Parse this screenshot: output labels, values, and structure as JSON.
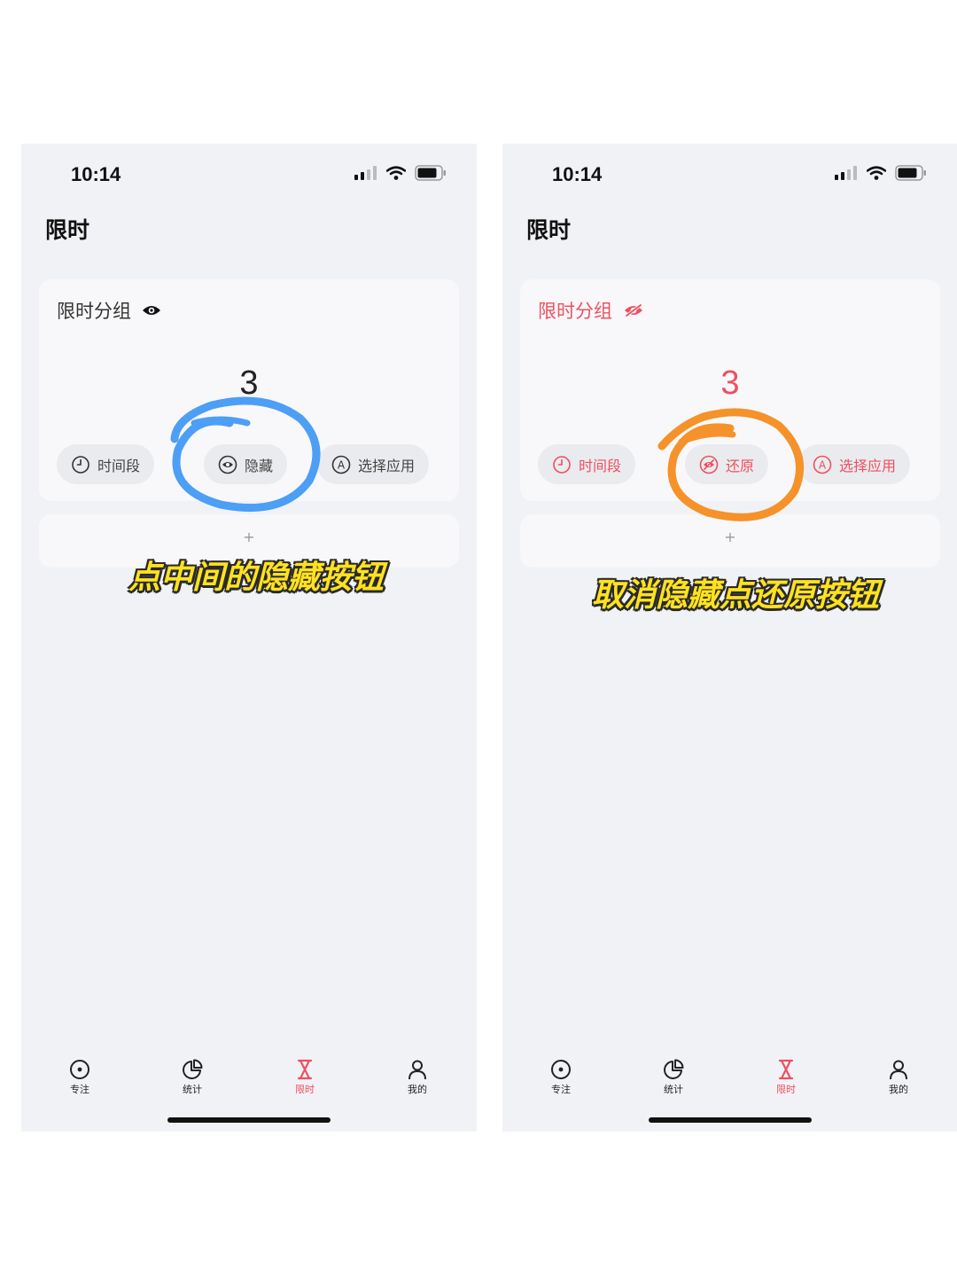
{
  "left": {
    "status": {
      "time": "10:14"
    },
    "page_title": "限时",
    "group": {
      "title": "限时分组",
      "count": "3"
    },
    "chips": {
      "time_range": "时间段",
      "hide": "隐藏",
      "select_app": "选择应用"
    },
    "add": "+",
    "tabs": {
      "focus": "专注",
      "stats": "统计",
      "limit": "限时",
      "mine": "我的"
    },
    "caption": "点中间的隐藏按钮"
  },
  "right": {
    "status": {
      "time": "10:14"
    },
    "page_title": "限时",
    "group": {
      "title": "限时分组",
      "count": "3"
    },
    "chips": {
      "time_range": "时间段",
      "restore": "还原",
      "select_app": "选择应用"
    },
    "add": "+",
    "tabs": {
      "focus": "专注",
      "stats": "统计",
      "limit": "限时",
      "mine": "我的"
    },
    "caption": "取消隐藏点还原按钮"
  },
  "colors": {
    "accent": "#ee5060",
    "blue_mark": "#4d9ef5",
    "orange_mark": "#f5922a",
    "caption": "#ffe21f"
  }
}
